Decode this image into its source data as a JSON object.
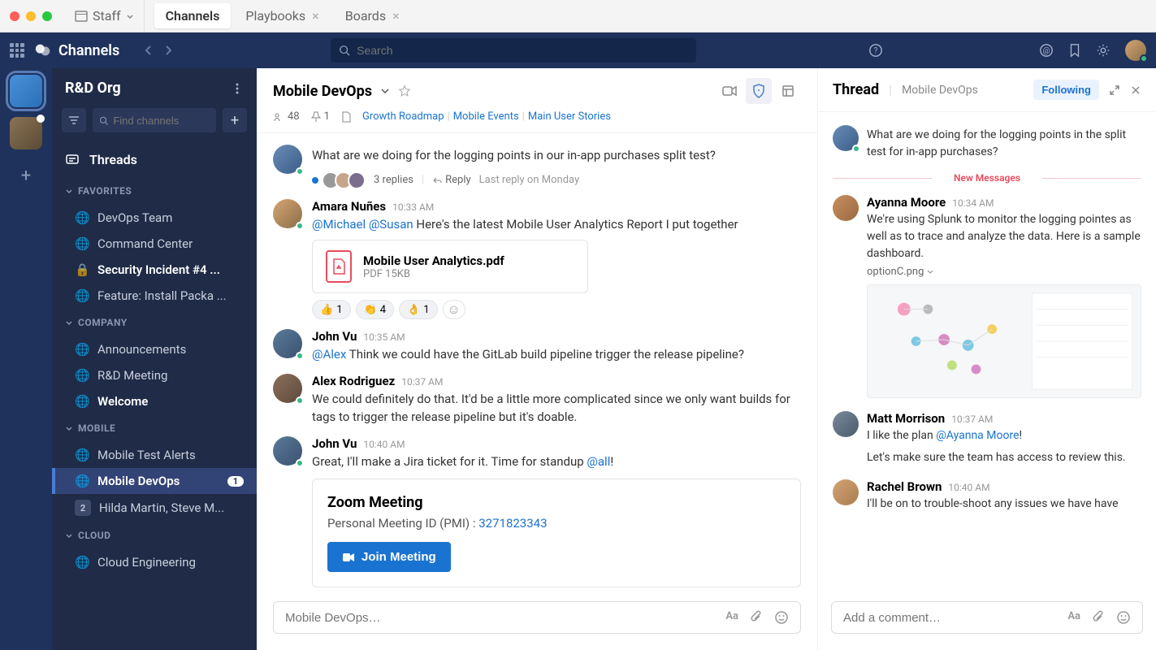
{
  "titlebar": {
    "staff_label": "Staff",
    "tabs": [
      {
        "label": "Channels",
        "active": true
      },
      {
        "label": "Playbooks",
        "active": false
      },
      {
        "label": "Boards",
        "active": false
      }
    ]
  },
  "global_header": {
    "brand": "Channels",
    "search_placeholder": "Search"
  },
  "sidebar": {
    "org_name": "R&D Org",
    "find_placeholder": "Find channels",
    "threads_label": "Threads",
    "sections": {
      "favorites": {
        "title": "FAVORITES",
        "items": [
          {
            "icon": "globe",
            "label": "DevOps Team"
          },
          {
            "icon": "globe",
            "label": "Command Center"
          },
          {
            "icon": "lock",
            "label": "Security Incident #4 ...",
            "bold": true
          },
          {
            "icon": "globe",
            "label": "Feature: Install Packa ..."
          }
        ]
      },
      "company": {
        "title": "COMPANY",
        "items": [
          {
            "icon": "globe",
            "label": "Announcements"
          },
          {
            "icon": "globe",
            "label": "R&D Meeting"
          },
          {
            "icon": "globe",
            "label": "Welcome",
            "bold": true
          }
        ]
      },
      "mobile": {
        "title": "MOBILE",
        "items": [
          {
            "icon": "globe",
            "label": "Mobile Test Alerts"
          },
          {
            "icon": "globe",
            "label": "Mobile DevOps",
            "active": true,
            "badge": "1",
            "bold": true
          },
          {
            "icon": "num",
            "num": "2",
            "label": "Hilda Martin, Steve M..."
          }
        ]
      },
      "cloud": {
        "title": "CLOUD",
        "items": [
          {
            "icon": "globe",
            "label": "Cloud Engineering"
          }
        ]
      }
    }
  },
  "channel": {
    "name": "Mobile DevOps",
    "members": "48",
    "pinned": "1",
    "links": [
      "Growth Roadmap",
      "Mobile Events",
      "Main User Stories"
    ],
    "compose_placeholder": "Mobile DevOps…"
  },
  "messages": {
    "m0": {
      "text": "What are we doing for the logging points in our in-app purchases split test?",
      "replies": "3 replies",
      "reply_label": "Reply",
      "last_reply": "Last reply on Monday"
    },
    "m1": {
      "author": "Amara Nuñes",
      "time": "10:33 AM",
      "mention1": "@Michael",
      "mention2": "@Susan",
      "text": " Here's the latest Mobile User Analytics Report I put together",
      "file_name": "Mobile User Analytics.pdf",
      "file_meta": "PDF 15KB",
      "reactions": [
        {
          "emoji": "👍",
          "count": "1"
        },
        {
          "emoji": "👏",
          "count": "4"
        },
        {
          "emoji": "👌",
          "count": "1"
        }
      ]
    },
    "m2": {
      "author": "John Vu",
      "time": "10:35 AM",
      "mention": "@Alex",
      "text": " Think we could have the GitLab build pipeline trigger the release pipeline?"
    },
    "m3": {
      "author": "Alex Rodriguez",
      "time": "10:37 AM",
      "text": "We could definitely do that. It'd be a little more complicated since we only want builds for tags to trigger the release pipeline but it's doable."
    },
    "m4": {
      "author": "John Vu",
      "time": "10:40 AM",
      "text_pre": "Great, I'll make a Jira ticket for it. Time for standup ",
      "mention": "@all",
      "text_post": "!",
      "meeting_title": "Zoom Meeting",
      "meeting_id_label": "Personal Meeting ID (PMI) : ",
      "meeting_id": "3271823343",
      "join_label": "Join Meeting"
    }
  },
  "thread": {
    "title": "Thread",
    "subtitle": "Mobile DevOps",
    "following_label": "Following",
    "new_messages_label": "New Messages",
    "root": {
      "text": "What are we doing for the logging points in the split test for in-app purchases?"
    },
    "t1": {
      "author": "Ayanna Moore",
      "time": "10:34 AM",
      "text": "We're using Splunk to monitor the logging pointes as well as to trace and analyze the data. Here is a sample dashboard.",
      "image_caption": "optionC.png"
    },
    "t2": {
      "author": "Matt Morrison",
      "time": "10:37 AM",
      "text_pre": "I like the plan ",
      "mention": "@Ayanna Moore",
      "text_post": "!",
      "text2": "Let's make sure the team has access to review this."
    },
    "t3": {
      "author": "Rachel Brown",
      "time": "10:40 AM",
      "text": "I'll be on to trouble-shoot any issues we have have"
    },
    "compose_placeholder": "Add a comment…"
  }
}
